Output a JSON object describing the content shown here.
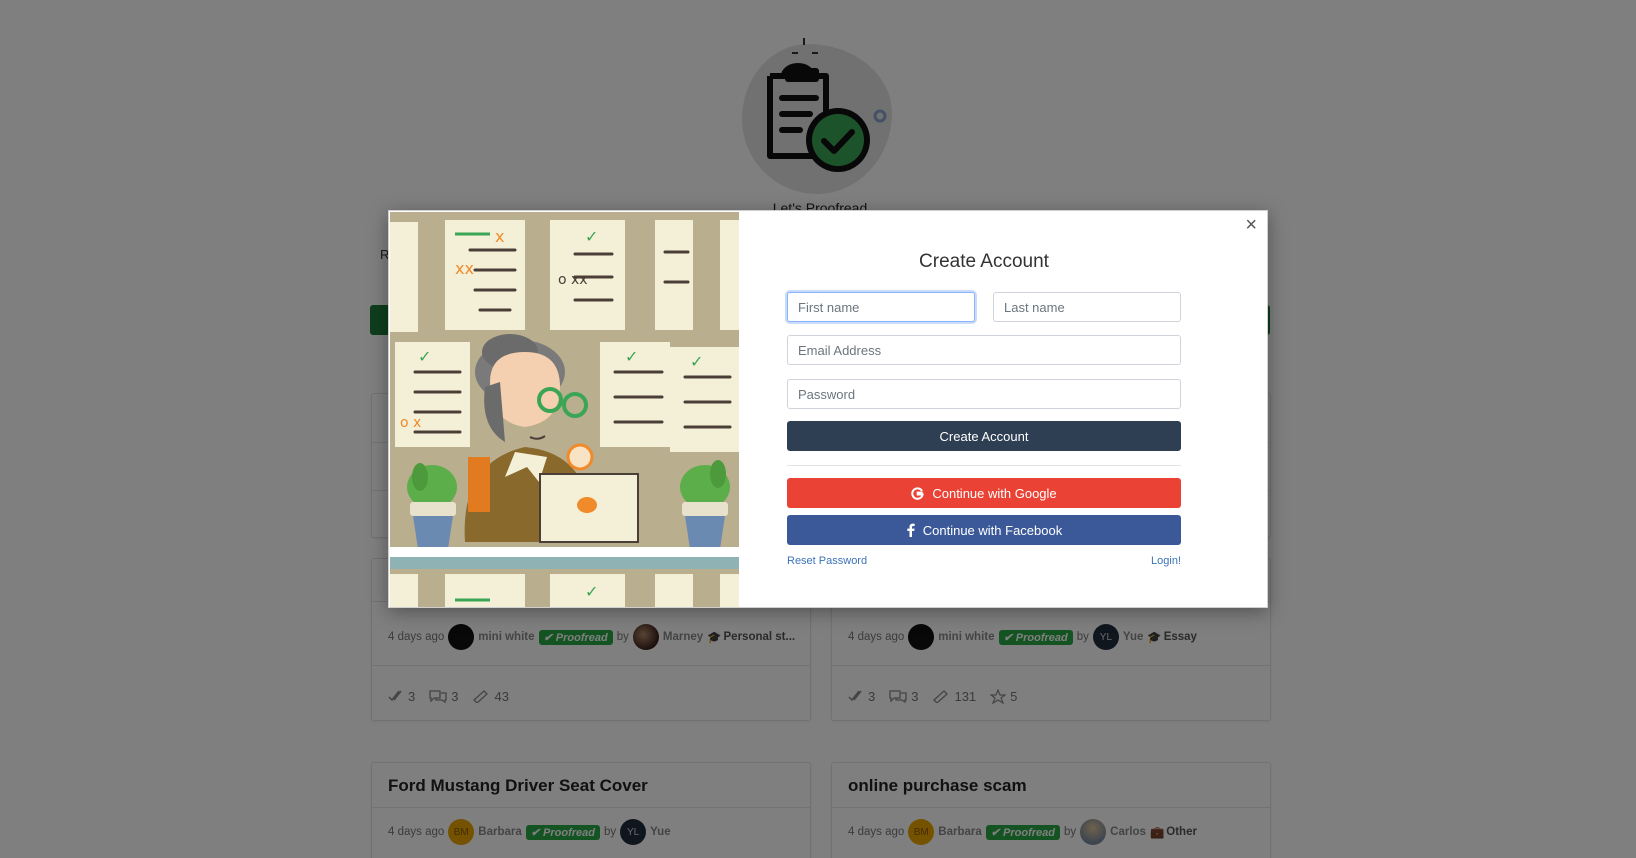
{
  "site": {
    "name": "Let's Proofread"
  },
  "posts": [
    {
      "title": "",
      "ago": "",
      "author": "",
      "status": "",
      "by": "",
      "reviewer": "",
      "category": "",
      "stats": {}
    },
    {
      "title": "",
      "ago": "",
      "author": "",
      "status": "",
      "by": "",
      "reviewer": "",
      "category": "",
      "stats": {}
    },
    {
      "title": "",
      "ago": "4 days ago",
      "author": "mini white",
      "status": "Proofread",
      "by": "by",
      "reviewer": "Marney",
      "category": "Personal st...",
      "stats": {
        "checks": "3",
        "comments": "3",
        "length": "43"
      }
    },
    {
      "title": "",
      "ago": "4 days ago",
      "author": "mini white",
      "status": "Proofread",
      "by": "by",
      "reviewer_initials": "YL",
      "reviewer": "Yue",
      "category": "Essay",
      "stats": {
        "checks": "3",
        "comments": "3",
        "length": "131",
        "stars": "5"
      }
    },
    {
      "title": "Ford Mustang Driver Seat Cover",
      "ago": "4 days ago",
      "author_initials": "BM",
      "author": "Barbara",
      "status": "Proofread",
      "by": "by",
      "reviewer_initials": "YL",
      "reviewer": "Yue"
    },
    {
      "title": "online purchase scam",
      "ago": "4 days ago",
      "author_initials": "BM",
      "author": "Barbara",
      "status": "Proofread",
      "by": "by",
      "reviewer": "Carlos",
      "category": "Other"
    }
  ],
  "modal": {
    "title": "Create Account",
    "close_label": "×",
    "first_name_placeholder": "First name",
    "last_name_placeholder": "Last name",
    "email_placeholder": "Email Address",
    "password_placeholder": "Password",
    "create_button": "Create Account",
    "google_button": "Continue with Google",
    "facebook_button": "Continue with Facebook",
    "reset_link": "Reset Password",
    "login_link": "Login!"
  },
  "colors": {
    "accent": "#2e3e53",
    "google": "#ea4335",
    "facebook": "#3b5998",
    "proofread_badge": "#28a745"
  }
}
